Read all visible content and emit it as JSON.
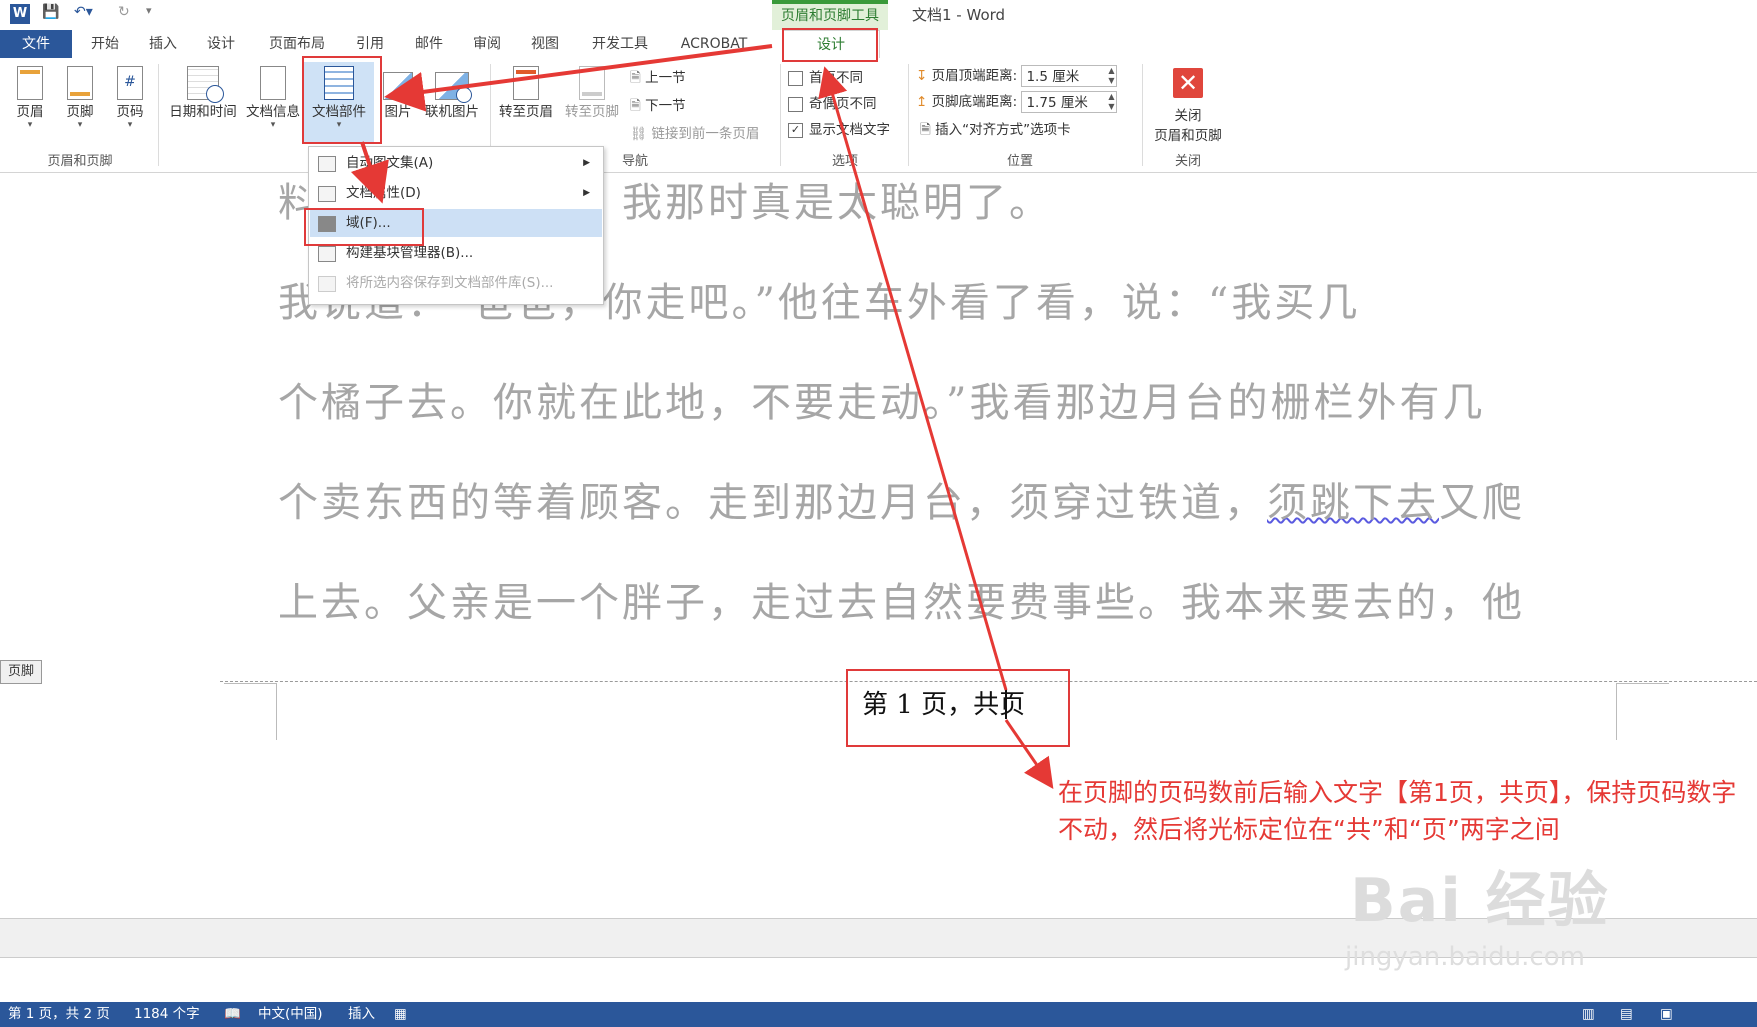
{
  "window": {
    "title": "文档1 - Word",
    "context_group": "页眉和页脚工具"
  },
  "tabs": [
    "文件",
    "开始",
    "插入",
    "设计",
    "页面布局",
    "引用",
    "邮件",
    "审阅",
    "视图",
    "开发工具",
    "ACROBAT",
    "设计"
  ],
  "ribbon": {
    "hf_group": {
      "header": "页眉",
      "footer": "页脚",
      "page_number": "页码",
      "label": "页眉和页脚"
    },
    "insert_group": {
      "date_time": "日期和时间",
      "doc_info": "文档信息",
      "doc_parts": "文档部件",
      "picture": "图片",
      "online_picture": "联机图片"
    },
    "nav_group": {
      "goto_header": "转至页眉",
      "goto_footer": "转至页脚",
      "prev_section": "上一节",
      "next_section": "下一节",
      "link_previous": "链接到前一条页眉",
      "label": "导航"
    },
    "options_group": {
      "first_page_diff": "首页不同",
      "odd_even_diff": "奇偶页不同",
      "show_doc_text": "显示文档文字",
      "show_doc_text_checked": "✓",
      "label": "选项"
    },
    "position_group": {
      "header_top_label": "页眉顶端距离:",
      "header_top_value": "1.5 厘米",
      "footer_bottom_label": "页脚底端距离:",
      "footer_bottom_value": "1.75 厘米",
      "insert_align_tab": "插入“对齐方式”选项卡",
      "label": "位置"
    },
    "close_group": {
      "close_line1": "关闭",
      "close_line2": "页眉和页脚",
      "label": "关闭"
    }
  },
  "menu": {
    "items": [
      {
        "label": "自动图文集(A)",
        "submenu": true
      },
      {
        "label": "文档属性(D)",
        "submenu": true
      },
      {
        "label": "域(F)...",
        "submenu": false
      },
      {
        "label": "构建基块管理器(B)...",
        "submenu": false
      },
      {
        "label": "将所选内容保存到文档部件库(S)...",
        "submenu": false
      }
    ]
  },
  "document": {
    "line1": "料。我现在想想，我那时真是太聪明了。",
    "line2": "我说道：“爸爸，你走吧。”他往车外看了看，说：“我买几",
    "line3": "个橘子去。你就在此地，不要走动。”我看那边月台的栅栏外有几",
    "line4a": "个卖东西的等着顾客。走到那边月台，须穿过铁道，",
    "line4b": "须跳下去",
    "line4c": "又爬",
    "line5": "上去。父亲是一个胖子，走过去自然要费事些。我本来要去的，他",
    "footer_label": "页脚",
    "footer_text": "第 1 页，共页"
  },
  "annotation": "在页脚的页码数前后输入文字【第1页，共页】，保持页码数字不动，然后将光标定位在“共”和“页”两字之间",
  "status": {
    "page": "第 1 页，共 2 页",
    "words": "1184 个字",
    "language": "中文(中国)",
    "mode": "插入"
  },
  "watermark": {
    "brand": "Bai 经验",
    "url": "jingyan.baidu.com"
  },
  "colors": {
    "accent": "#2b579a",
    "context": "#2e7d32",
    "callout": "#e53935"
  }
}
